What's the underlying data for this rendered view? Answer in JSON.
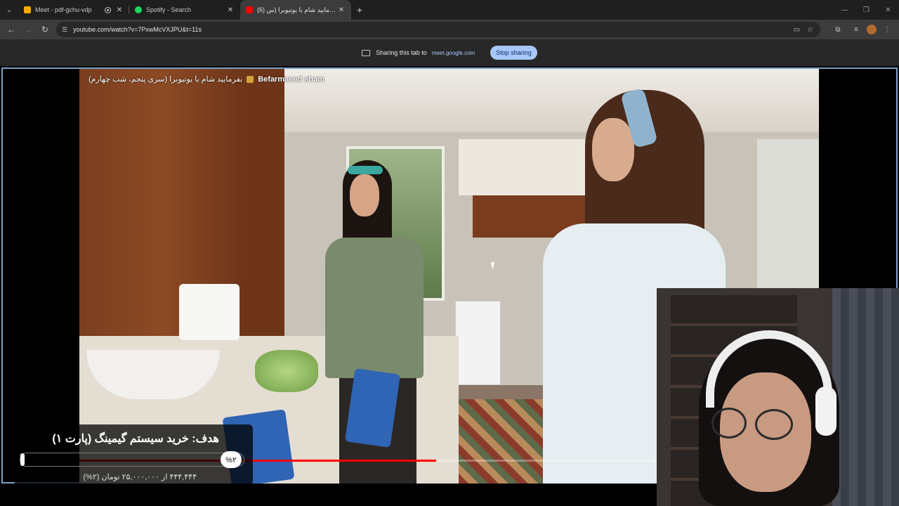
{
  "tabs": [
    {
      "title": "Meet - pdf-gchu-vdp",
      "favicon_color": "#f9ab00"
    },
    {
      "title": "Spotify - Search",
      "favicon_color": "#1ed760"
    },
    {
      "title": "(6) بفرمایید شام با یوتیوبرا (س...",
      "favicon_color": "#ff0000"
    }
  ],
  "toolbar": {
    "url": "youtube.com/watch?v=7PxwMcVXJPU&t=11s"
  },
  "sharebar": {
    "label": "Sharing this tab to",
    "host": "meet.google.com",
    "stop_label": "Stop sharing"
  },
  "video": {
    "title": "بفرمایید شام با یوتیوبرا (سری پنجم، شب چهارم)",
    "channel": "Befarmaeed sham",
    "progress": 0.62
  },
  "goal": {
    "text": "هدف: خرید سیستم گیمینگ (پارت ۱)",
    "percent_label": "%۲",
    "percent": 0.02,
    "amount": "۴۴۴,۴۴۴ از ۲۵,۰۰۰,۰۰۰ تومان (۲%)"
  },
  "colors": {
    "accent": "#a8c7fa",
    "share_border": "#7aa0c8",
    "progress": "#ff0000"
  }
}
